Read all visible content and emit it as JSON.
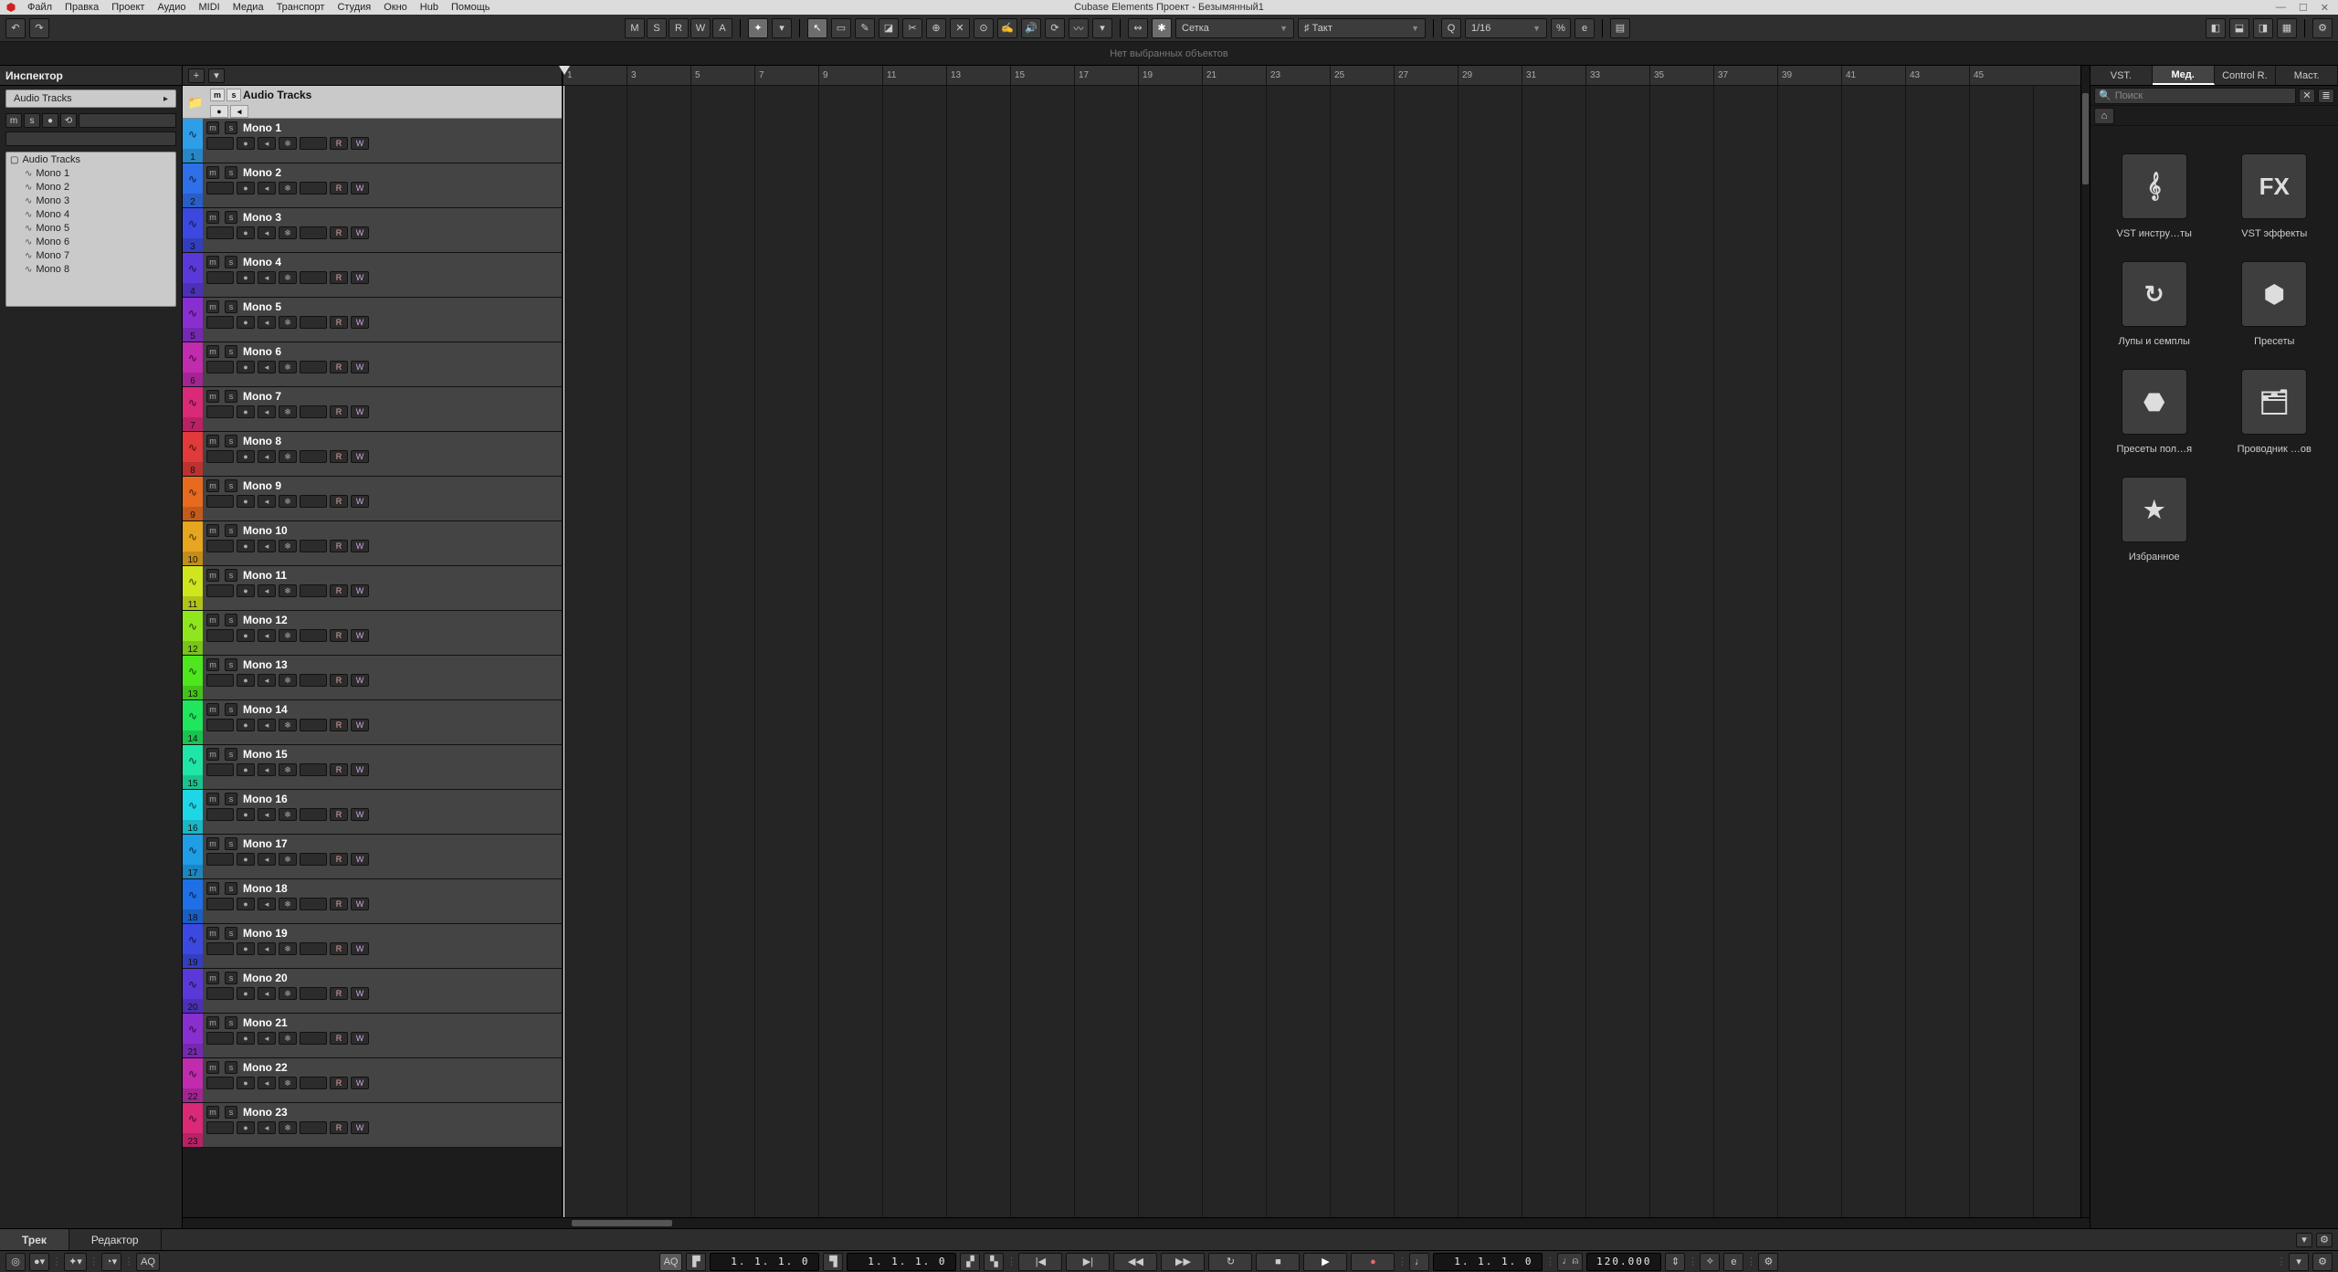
{
  "app": {
    "title": "Cubase Elements Проект - Безымянный1",
    "menus": [
      "Файл",
      "Правка",
      "Проект",
      "Аудио",
      "MIDI",
      "Медиа",
      "Транспорт",
      "Студия",
      "Окно",
      "Hub",
      "Помощь"
    ]
  },
  "toolbar": {
    "msrwa": [
      "M",
      "S",
      "R",
      "W",
      "A"
    ],
    "snap_label": "Сетка",
    "grid_label": "Такт",
    "quantize_label": "1/16"
  },
  "info_strip": "Нет выбранных объектов",
  "inspector": {
    "title": "Инспектор",
    "chip": "Audio Tracks",
    "mini": [
      "m",
      "s",
      "●",
      "⟲"
    ],
    "tree_root": "Audio Tracks",
    "tree_children": [
      "Mono 1",
      "Mono 2",
      "Mono 3",
      "Mono 4",
      "Mono 5",
      "Mono 6",
      "Mono 7",
      "Mono 8"
    ]
  },
  "track_header": {
    "title": "Audio Tracks"
  },
  "ruler_numbers": [
    1,
    3,
    5,
    7,
    9,
    11,
    13,
    15,
    17,
    19,
    21,
    23,
    25,
    27,
    29,
    31,
    33,
    35,
    37,
    39,
    41,
    43,
    45
  ],
  "tracks": [
    {
      "n": 1,
      "name": "Mono 1",
      "color": "#2f9ee8"
    },
    {
      "n": 2,
      "name": "Mono 2",
      "color": "#2f6fe8"
    },
    {
      "n": 3,
      "name": "Mono 3",
      "color": "#3c49e0"
    },
    {
      "n": 4,
      "name": "Mono 4",
      "color": "#5a39d8"
    },
    {
      "n": 5,
      "name": "Mono 5",
      "color": "#8a2fcf"
    },
    {
      "n": 6,
      "name": "Mono 6",
      "color": "#c12bae"
    },
    {
      "n": 7,
      "name": "Mono 7",
      "color": "#d92977"
    },
    {
      "n": 8,
      "name": "Mono 8",
      "color": "#e03a3a"
    },
    {
      "n": 9,
      "name": "Mono 9",
      "color": "#e66b1f"
    },
    {
      "n": 10,
      "name": "Mono 10",
      "color": "#e6a61f"
    },
    {
      "n": 11,
      "name": "Mono 11",
      "color": "#cfe61f"
    },
    {
      "n": 12,
      "name": "Mono 12",
      "color": "#8fe61f"
    },
    {
      "n": 13,
      "name": "Mono 13",
      "color": "#4fe61f"
    },
    {
      "n": 14,
      "name": "Mono 14",
      "color": "#1fe65d"
    },
    {
      "n": 15,
      "name": "Mono 15",
      "color": "#1fe6a6"
    },
    {
      "n": 16,
      "name": "Mono 16",
      "color": "#1fd6e6"
    },
    {
      "n": 17,
      "name": "Mono 17",
      "color": "#1f9ee6"
    },
    {
      "n": 18,
      "name": "Mono 18",
      "color": "#1f6fe6"
    },
    {
      "n": 19,
      "name": "Mono 19",
      "color": "#3c49e0"
    },
    {
      "n": 20,
      "name": "Mono 20",
      "color": "#5a39d8"
    },
    {
      "n": 21,
      "name": "Mono 21",
      "color": "#8a2fcf"
    },
    {
      "n": 22,
      "name": "Mono 22",
      "color": "#c12bae"
    },
    {
      "n": 23,
      "name": "Mono 23",
      "color": "#d92977"
    }
  ],
  "right_panel": {
    "tabs": [
      "VST.",
      "Мед.",
      "Control R.",
      "Маст."
    ],
    "active_tab": 1,
    "search_placeholder": "Поиск",
    "items": [
      {
        "label": "VST инстру…ты",
        "glyph": "piano"
      },
      {
        "label": "VST эффекты",
        "glyph": "FX"
      },
      {
        "label": "Лупы и семплы",
        "glyph": "loop"
      },
      {
        "label": "Пресеты",
        "glyph": "hex"
      },
      {
        "label": "Пресеты пол…я",
        "glyph": "hex2"
      },
      {
        "label": "Проводник …ов",
        "glyph": "browse"
      },
      {
        "label": "Избранное",
        "glyph": "star"
      }
    ]
  },
  "lower_tabs": {
    "tabs": [
      "Трек",
      "Редактор"
    ],
    "active": 0
  },
  "transport": {
    "aq": "AQ",
    "left_pos": "1.  1.  1.    0",
    "right_pos": "1.  1.  1.    0",
    "primary_pos": "1.  1.  1.    0",
    "tempo": "120.000"
  }
}
